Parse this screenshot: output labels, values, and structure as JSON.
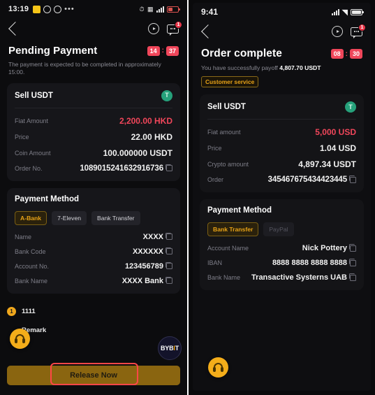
{
  "left": {
    "status_bar": {
      "time": "13:19",
      "icons": [
        "yellow-app-icon",
        "whatsapp-icon",
        "whatsapp-icon",
        "more-dots-icon",
        "alarm-icon",
        "vpn-icon",
        "signal-icon",
        "battery-icon"
      ]
    },
    "nav": {
      "back_icon": "chevron-left-icon",
      "play_icon": "play-circle-icon",
      "chat_icon": "chat-bubble-icon",
      "chat_badge": "1"
    },
    "header": {
      "title": "Pending Payment",
      "timer_minutes": "14",
      "timer_colon": ":",
      "timer_seconds": "37",
      "subtitle": "The payment is expected to be completed in approximately 15:00."
    },
    "order_card": {
      "title": "Sell USDT",
      "token_symbol": "T",
      "rows": [
        {
          "label": "Fiat Amount",
          "value": "2,200.00 HKD",
          "style": "red",
          "copy": false
        },
        {
          "label": "Price",
          "value": "22.00 HKD",
          "style": "big",
          "copy": false
        },
        {
          "label": "Coin Amount",
          "value": "100.000000 USDT",
          "style": "big",
          "copy": false
        },
        {
          "label": "Order No.",
          "value": "1089015241632916736",
          "style": "order",
          "copy": true
        }
      ]
    },
    "payment_card": {
      "title": "Payment Method",
      "tabs": [
        {
          "label": "A-Bank",
          "state": "active"
        },
        {
          "label": "7-Eleven",
          "state": "default"
        },
        {
          "label": "Bank Transfer",
          "state": "default"
        }
      ],
      "rows": [
        {
          "label": "Name",
          "value": "XXXX",
          "copy": true
        },
        {
          "label": "Bank Code",
          "value": "XXXXXX",
          "copy": true
        },
        {
          "label": "Account No.",
          "value": "123456789",
          "copy": true
        },
        {
          "label": "Bank Name",
          "value": "XXXX Bank",
          "copy": true
        }
      ]
    },
    "steps": [
      {
        "badge": "1",
        "label": "1111"
      },
      {
        "badge": "",
        "label": "Remark"
      }
    ],
    "support_icon": "headset-support-icon",
    "brand": {
      "text_a": "BYB",
      "text_i": "I",
      "text_t": "T"
    },
    "release_button": "Release Now",
    "annotation": "red-highlight-box"
  },
  "right": {
    "status_bar": {
      "time": "9:41",
      "icons": [
        "signal-icon",
        "wifi-icon",
        "battery-icon"
      ]
    },
    "nav": {
      "back_icon": "chevron-left-icon",
      "play_icon": "play-circle-icon",
      "chat_icon": "chat-bubble-icon",
      "chat_badge": "1"
    },
    "header": {
      "title": "Order complete",
      "timer_minutes": "08",
      "timer_colon": ":",
      "timer_seconds": "30",
      "subtitle_prefix": "You have successfully payoff ",
      "subtitle_amount": "4,807.70 USDT",
      "customer_service_chip": "Customer service"
    },
    "order_card": {
      "title": "Sell USDT",
      "token_symbol": "T",
      "rows": [
        {
          "label": "Fiat amount",
          "value": "5,000 USD",
          "style": "red",
          "copy": false
        },
        {
          "label": "Price",
          "value": "1.04 USD",
          "style": "big",
          "copy": false
        },
        {
          "label": "Crypto amount",
          "value": "4,897.34 USDT",
          "style": "big",
          "copy": false
        },
        {
          "label": "Order",
          "value": "345467675434423445",
          "style": "order",
          "copy": true
        }
      ]
    },
    "payment_card": {
      "title": "Payment Method",
      "tabs": [
        {
          "label": "Bank Transfer",
          "state": "active"
        },
        {
          "label": "PayPal",
          "state": "muted"
        }
      ],
      "rows": [
        {
          "label": "Account Name",
          "value": "Nick Pottery",
          "copy": true
        },
        {
          "label": "IBAN",
          "value": "8888 8888 8888 8888",
          "copy": true
        },
        {
          "label": "Bank Name",
          "value": "Transactive Systerns UAB",
          "copy": true
        }
      ]
    },
    "support_icon": "headset-support-icon"
  }
}
